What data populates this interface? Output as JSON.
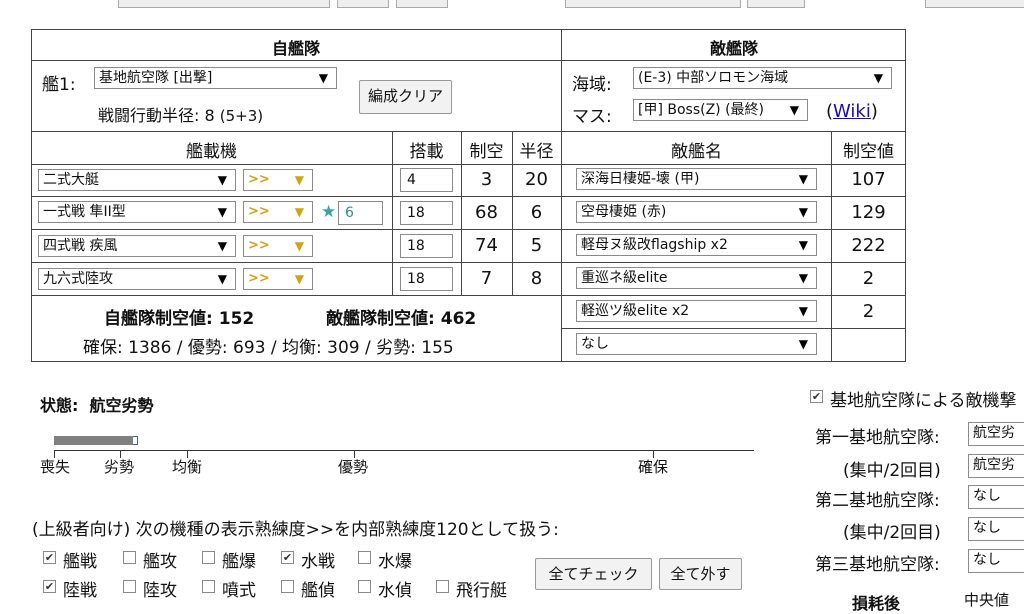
{
  "fleet": {
    "header": "自艦隊",
    "ship_label": "艦1:",
    "ship_select": "基地航空隊 [出撃]",
    "radius_label": "戦闘行動半径:",
    "radius_value": "8",
    "radius_detail": "(5+3)",
    "clear_button": "編成クリア",
    "col_aircraft": "艦載機",
    "col_slot": "搭載",
    "col_air": "制空",
    "col_radius": "半径",
    "rows": [
      {
        "plane": "二式大艇",
        "prof": ">>",
        "star": "",
        "slot": "4",
        "air": "3",
        "radius": "20"
      },
      {
        "plane": "一式戦 隼II型",
        "prof": ">>",
        "star": "★",
        "improve": "6",
        "slot": "18",
        "air": "68",
        "radius": "6"
      },
      {
        "plane": "四式戦 疾風",
        "prof": ">>",
        "star": "",
        "slot": "18",
        "air": "74",
        "radius": "5"
      },
      {
        "plane": "九六式陸攻",
        "prof": ">>",
        "star": "",
        "slot": "18",
        "air": "7",
        "radius": "8"
      }
    ],
    "total_air_label": "自艦隊制空値:",
    "total_air_value": "152",
    "enemy_air_label": "敵艦隊制空値:",
    "enemy_air_value": "462",
    "thresholds": "確保: 1386 / 優勢: 693 / 均衡: 309 / 劣勢: 155"
  },
  "enemy": {
    "header": "敵艦隊",
    "area_label": "海域:",
    "area_select": "(E-3) 中部ソロモン海域",
    "node_label": "マス:",
    "node_select": "[甲] Boss(Z) (最終)",
    "wiki_open": "(",
    "wiki_link": "Wiki",
    "wiki_close": ")",
    "col_name": "敵艦名",
    "col_air": "制空値",
    "ships": [
      {
        "name": "深海日棲姫-壊 (甲)",
        "air": "107"
      },
      {
        "name": "空母棲姫 (赤)",
        "air": "129"
      },
      {
        "name": "軽母ヌ級改flagship x2",
        "air": "222"
      },
      {
        "name": "重巡ネ級elite",
        "air": "2"
      },
      {
        "name": "軽巡ツ級elite x2",
        "air": "2"
      },
      {
        "name": "なし",
        "air": ""
      }
    ]
  },
  "status": {
    "label": "状態:",
    "value": "航空劣勢",
    "bar_fraction": 0.25,
    "ticks": [
      "喪失",
      "劣勢",
      "均衡",
      "優勢",
      "確保"
    ],
    "bar_color": "#808080",
    "marker_color": "#3a5fcd"
  },
  "proficiency": {
    "note": "(上級者向け) 次の機種の表示熟練度>>を内部熟練度120として扱う:",
    "items_row1": [
      {
        "label": "艦戦",
        "checked": true
      },
      {
        "label": "艦攻",
        "checked": false
      },
      {
        "label": "艦爆",
        "checked": false
      },
      {
        "label": "水戦",
        "checked": true
      },
      {
        "label": "水爆",
        "checked": false
      }
    ],
    "items_row2": [
      {
        "label": "陸戦",
        "checked": true
      },
      {
        "label": "陸攻",
        "checked": false
      },
      {
        "label": "噴式",
        "checked": false
      },
      {
        "label": "艦偵",
        "checked": false
      },
      {
        "label": "水偵",
        "checked": false
      },
      {
        "label": "飛行艇",
        "checked": false
      }
    ],
    "check_all": "全てチェック",
    "uncheck_all": "全て外す"
  },
  "base": {
    "checkbox_label": "基地航空隊による敵機撃",
    "rows": [
      {
        "label": "第一基地航空隊:",
        "value": "航空劣"
      },
      {
        "label": "(集中/2回目)",
        "value": "航空劣"
      },
      {
        "label": "第二基地航空隊:",
        "value": "なし"
      },
      {
        "label": "(集中/2回目)",
        "value": "なし"
      },
      {
        "label": "第三基地航空隊:",
        "value": "なし"
      }
    ],
    "loss_label": "損耗後",
    "median_label": "中央値"
  },
  "icons": {
    "dropdown": "▼",
    "star": "★",
    "check": "✔"
  }
}
